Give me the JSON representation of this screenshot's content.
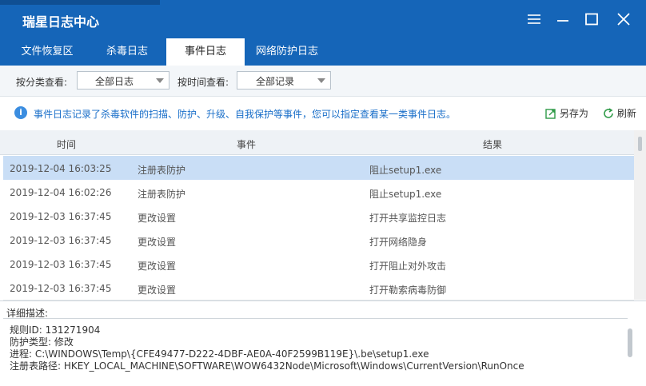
{
  "window": {
    "title": "瑞星日志中心",
    "controls": [
      "settings-icon",
      "minimize-icon",
      "maximize-icon",
      "close-icon"
    ]
  },
  "tabs": [
    {
      "label": "文件恢复区",
      "active": false
    },
    {
      "label": "杀毒日志",
      "active": false
    },
    {
      "label": "事件日志",
      "active": true
    },
    {
      "label": "网络防护日志",
      "active": false
    }
  ],
  "filters": {
    "category_label": "按分类查看:",
    "category_value": "全部日志",
    "time_label": "按时间查看:",
    "time_value": "全部记录"
  },
  "info": {
    "text": "事件日志记录了杀毒软件的扫描、防护、升级、自我保护等事件，您可以指定查看某一类事件日志。",
    "save_as": "另存为",
    "refresh": "刷新"
  },
  "table": {
    "headers": [
      "时间",
      "事件",
      "结果"
    ],
    "rows": [
      {
        "time": "2019-12-04 16:03:25",
        "event": "注册表防护",
        "result": "阻止setup1.exe",
        "selected": true
      },
      {
        "time": "2019-12-04 16:02:26",
        "event": "注册表防护",
        "result": "阻止setup1.exe",
        "selected": false
      },
      {
        "time": "2019-12-03 16:37:45",
        "event": "更改设置",
        "result": "打开共享监控日志",
        "selected": false
      },
      {
        "time": "2019-12-03 16:37:45",
        "event": "更改设置",
        "result": "打开网络隐身",
        "selected": false
      },
      {
        "time": "2019-12-03 16:37:45",
        "event": "更改设置",
        "result": "打开阻止对外攻击",
        "selected": false
      },
      {
        "time": "2019-12-03 16:37:45",
        "event": "更改设置",
        "result": "打开勒索病毒防御",
        "selected": false
      }
    ]
  },
  "detail": {
    "label": "详细描述:",
    "lines": [
      "规则ID:  131271904",
      "防护类型:  修改",
      "进程:  C:\\WINDOWS\\Temp\\{CFE49477-D222-4DBF-AE0A-40F2599B119E}\\.be\\setup1.exe",
      "注册表路径:  HKEY_LOCAL_MACHINE\\SOFTWARE\\WOW6432Node\\Microsoft\\Windows\\CurrentVersion\\RunOnce"
    ]
  },
  "colors": {
    "titlebar": "#1565b8",
    "selected_row": "#c9def6",
    "info_text": "#1a6fc9"
  }
}
